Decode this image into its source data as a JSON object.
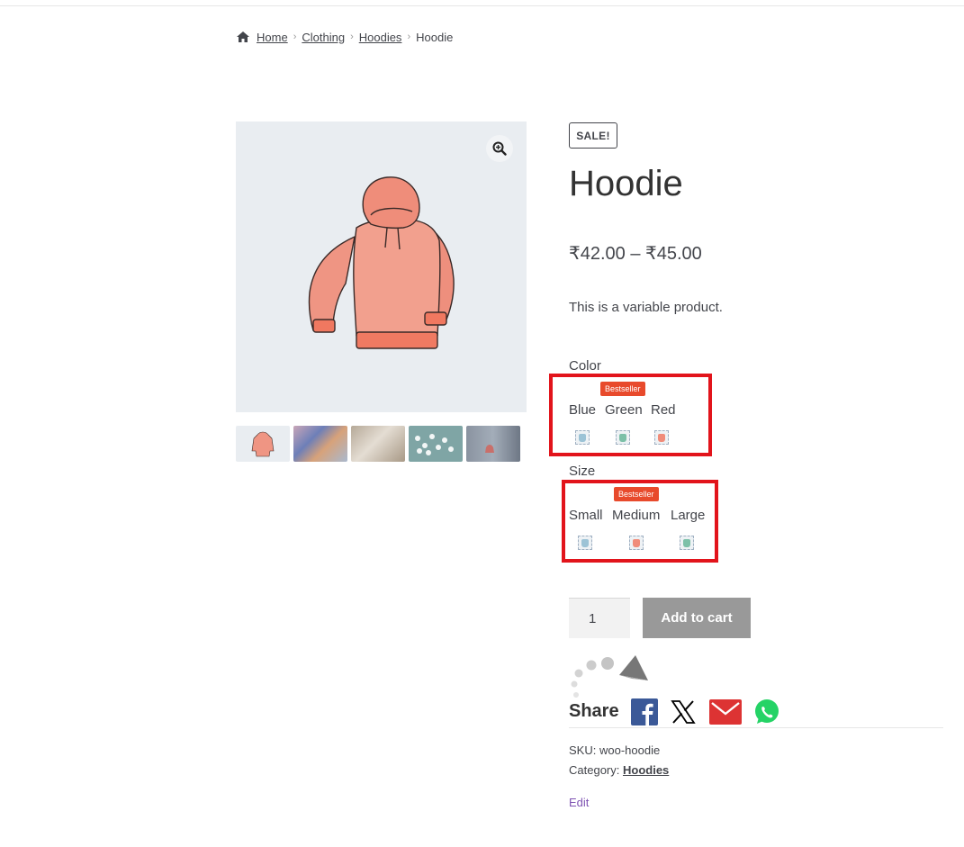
{
  "breadcrumb": {
    "home": "Home",
    "clothing": "Clothing",
    "hoodies": "Hoodies",
    "current": "Hoodie",
    "separator": "›"
  },
  "product": {
    "sale_badge": "SALE!",
    "title": "Hoodie",
    "price": "₹42.00 – ₹45.00",
    "description": "This is a variable product.",
    "color_label": "Color",
    "color_options": [
      "Blue",
      "Green",
      "Red"
    ],
    "size_label": "Size",
    "size_options": [
      "Small",
      "Medium",
      "Large"
    ],
    "bestseller_label": "Bestseller"
  },
  "cart": {
    "quantity": "1",
    "add_to_cart_label": "Add to cart"
  },
  "share": {
    "label": "Share",
    "networks": [
      "facebook-icon",
      "x-icon",
      "email-icon",
      "whatsapp-icon"
    ]
  },
  "meta": {
    "sku_label": "SKU:",
    "sku_value": "woo-hoodie",
    "category_label": "Category:",
    "category_value": "Hoodies",
    "edit_label": "Edit"
  },
  "colors": {
    "highlight": "#e2141b",
    "bestseller": "#e84a2c",
    "button_disabled": "#999999",
    "edit_link": "#7f54b3",
    "facebook": "#3b5998",
    "email": "#dd3333",
    "whatsapp": "#25d366",
    "hoodie": "#f08c7a"
  }
}
